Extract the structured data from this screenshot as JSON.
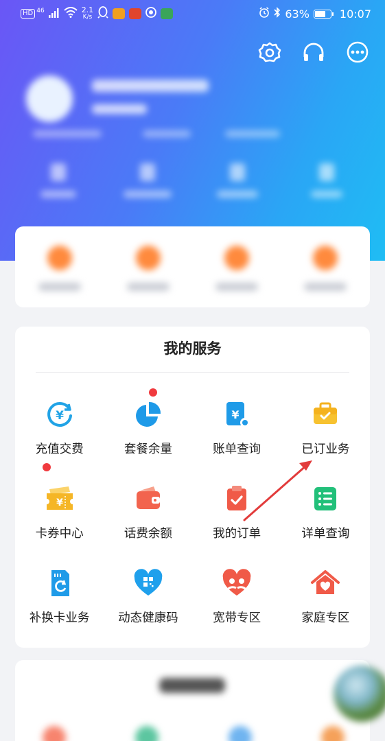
{
  "status_bar": {
    "hd": "HD",
    "net": "46",
    "speed_value": "2.1",
    "speed_unit": "K/s",
    "battery": "63%",
    "time": "10:07"
  },
  "top_icons": [
    "settings-icon",
    "headset-icon",
    "more-icon"
  ],
  "services": {
    "title": "我的服务",
    "items": [
      {
        "label": "充值交费",
        "icon": "yuan-recharge-icon",
        "badge": false
      },
      {
        "label": "套餐余量",
        "icon": "pie-chart-icon",
        "badge": true
      },
      {
        "label": "账单查询",
        "icon": "bill-icon",
        "badge": false
      },
      {
        "label": "已订业务",
        "icon": "briefcase-icon",
        "badge": false
      },
      {
        "label": "卡券中心",
        "icon": "coupon-icon",
        "badge": true
      },
      {
        "label": "话费余额",
        "icon": "wallet-icon",
        "badge": false
      },
      {
        "label": "我的订单",
        "icon": "order-clipboard-icon",
        "badge": false
      },
      {
        "label": "详单查询",
        "icon": "detail-list-icon",
        "badge": false
      },
      {
        "label": "补换卡业务",
        "icon": "sim-card-icon",
        "badge": false
      },
      {
        "label": "动态健康码",
        "icon": "health-code-heart-icon",
        "badge": false
      },
      {
        "label": "宽带专区",
        "icon": "broadband-heart-icon",
        "badge": false
      },
      {
        "label": "家庭专区",
        "icon": "home-icon",
        "badge": false
      }
    ]
  },
  "colors": {
    "header_start": "#6a56f6",
    "header_end": "#1fbdf4",
    "badge": "#f03a3e",
    "annotation": "#e23b3b"
  }
}
